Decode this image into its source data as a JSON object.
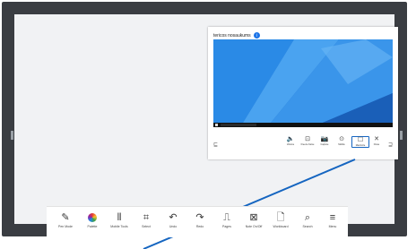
{
  "preview": {
    "title": "tericos nosaukums",
    "info_badge": "i",
    "mini_tools": [
      {
        "icon": "speaker-icon",
        "glyph": "🔈",
        "label": "Volume"
      },
      {
        "icon": "freeze-frame-icon",
        "glyph": "⊡",
        "label": "Freeze frame"
      },
      {
        "icon": "capture-icon",
        "glyph": "📷",
        "label": "Capture"
      },
      {
        "icon": "mobile-icon",
        "glyph": "⊙",
        "label": "Mobile"
      },
      {
        "icon": "maximize-icon",
        "glyph": "☐",
        "label": "Maximize"
      },
      {
        "icon": "close-icon",
        "glyph": "✕",
        "label": "Close"
      }
    ],
    "left_glyph": "⊑",
    "right_glyph": "⊒"
  },
  "toolbar": {
    "tools": [
      {
        "icon": "pen-icon",
        "glyph": "✎",
        "label": "Pen Mode"
      },
      {
        "icon": "palette-icon",
        "glyph": "",
        "label": "Palette"
      },
      {
        "icon": "brush-icon",
        "glyph": "⫴",
        "label": "Mobile Tools"
      },
      {
        "icon": "select-icon",
        "glyph": "⌗",
        "label": "Select"
      },
      {
        "icon": "undo-icon",
        "glyph": "↶",
        "label": "Undo"
      },
      {
        "icon": "redo-icon",
        "glyph": "↷",
        "label": "Redo"
      },
      {
        "icon": "pages-icon",
        "glyph": "⎍",
        "label": "Pages"
      },
      {
        "icon": "note-icon",
        "glyph": "⊠",
        "label": "Note On/Off"
      },
      {
        "icon": "workboard-icon",
        "glyph": "🗋",
        "label": "Workboard"
      },
      {
        "icon": "search-icon",
        "glyph": "⌕",
        "label": "Search"
      },
      {
        "icon": "menu-icon",
        "glyph": "≡",
        "label": "Menu"
      }
    ]
  },
  "colors": {
    "frame": "#3a3d42",
    "accent": "#1565c0",
    "desktop_blue": "#1e88e5"
  }
}
